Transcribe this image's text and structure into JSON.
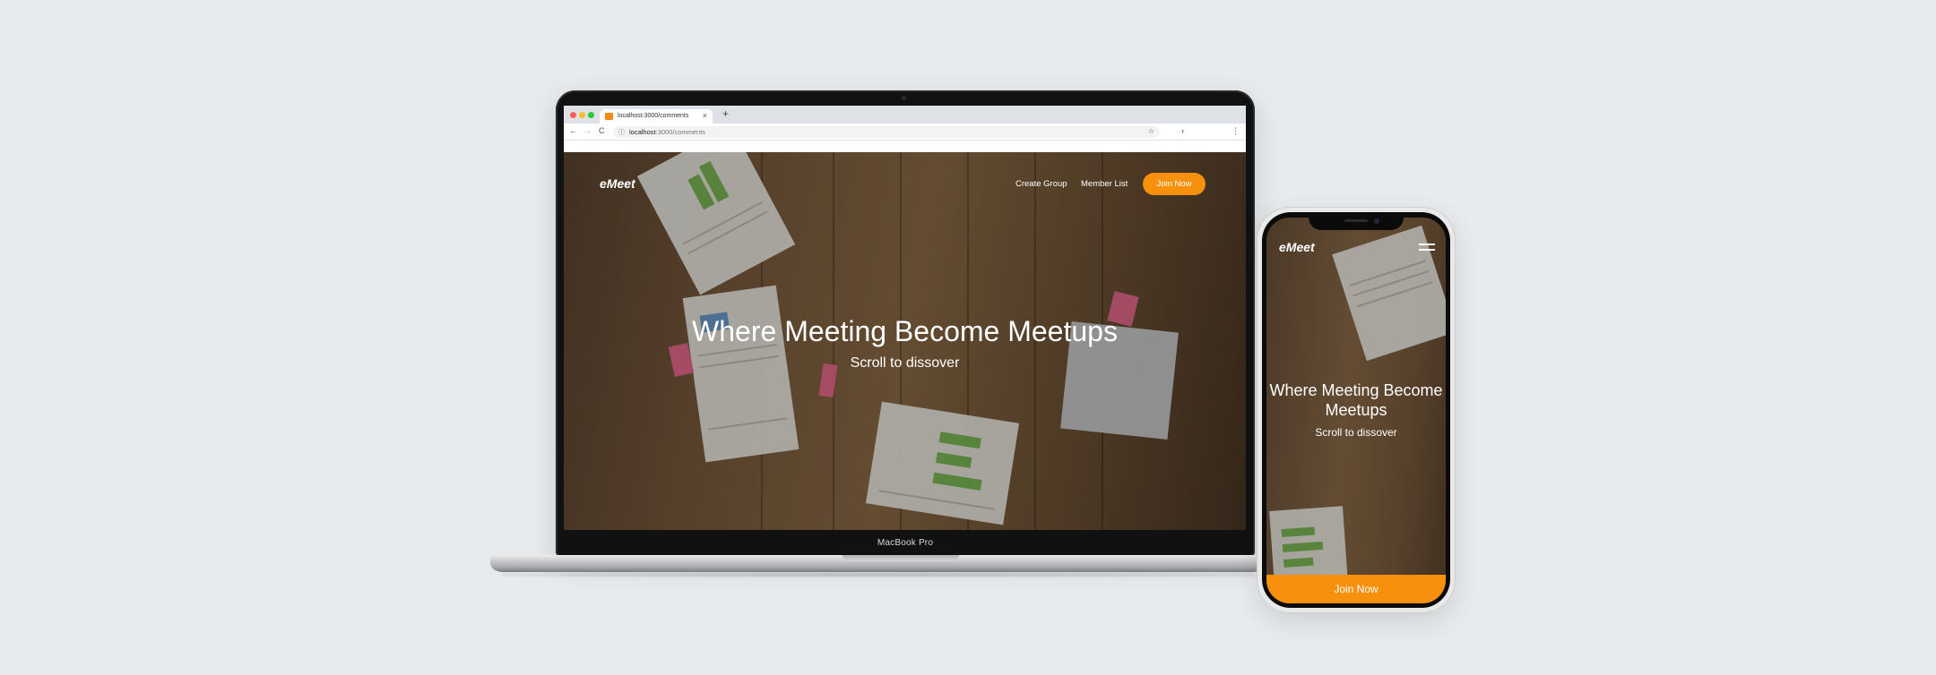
{
  "browser": {
    "tab_title": "localhost:3000/comments",
    "tab_close": "×",
    "new_tab": "+",
    "url_host": "localhost",
    "url_path": ":3000/comments",
    "info_icon": "ⓘ",
    "back_icon": "←",
    "forward_icon": "→",
    "reload_icon": "C",
    "star_icon": "☆",
    "extension_icon": "›",
    "menu_icon": "⋮"
  },
  "site": {
    "logo": "eMeet",
    "nav": {
      "create_group": "Create Group",
      "member_list": "Member List",
      "join_now": "Join Now"
    },
    "hero_title": "Where Meeting Become Meetups",
    "hero_subtitle": "Scroll to dissover"
  },
  "laptop": {
    "model": "MacBook Pro"
  },
  "phone_site": {
    "logo": "eMeet",
    "hero_title": "Where Meeting Become Meetups",
    "hero_subtitle": "Scroll to dissover",
    "join_now": "Join Now"
  },
  "colors": {
    "accent": "#f7900c",
    "background": "#e8ebee"
  }
}
